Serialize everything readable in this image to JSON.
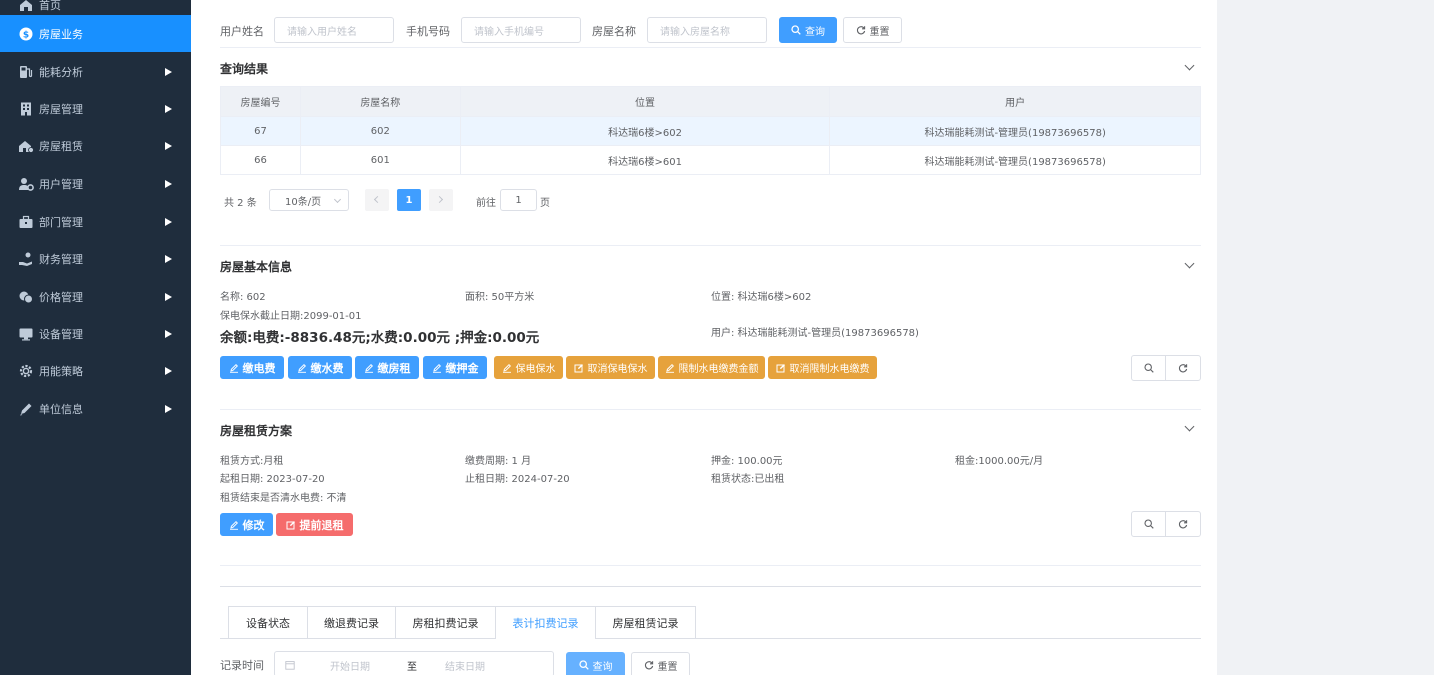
{
  "sidebar": {
    "items": [
      {
        "label": "首页",
        "icon": "home-icon"
      },
      {
        "label": "房屋业务",
        "icon": "dollar-icon",
        "active": true
      },
      {
        "label": "能耗分析",
        "icon": "gas-pump-icon"
      },
      {
        "label": "房屋管理",
        "icon": "building-icon"
      },
      {
        "label": "房屋租赁",
        "icon": "house-rent-icon"
      },
      {
        "label": "用户管理",
        "icon": "user-gear-icon"
      },
      {
        "label": "部门管理",
        "icon": "briefcase-icon"
      },
      {
        "label": "财务管理",
        "icon": "hand-money-icon"
      },
      {
        "label": "价格管理",
        "icon": "coins-icon"
      },
      {
        "label": "设备管理",
        "icon": "monitor-icon"
      },
      {
        "label": "用能策略",
        "icon": "gear-icon"
      },
      {
        "label": "单位信息",
        "icon": "pen-icon"
      }
    ]
  },
  "search": {
    "user_name_label": "用户姓名",
    "user_name_placeholder": "请输入用户姓名",
    "phone_label": "手机号码",
    "phone_placeholder": "请输入手机编号",
    "house_name_label": "房屋名称",
    "house_name_placeholder": "请输入房屋名称",
    "query_label": "查询",
    "reset_label": "重置"
  },
  "results": {
    "title": "查询结果",
    "columns": [
      "房屋编号",
      "房屋名称",
      "位置",
      "用户"
    ],
    "rows": [
      {
        "id": "67",
        "name": "602",
        "location": "科达瑞6楼>602",
        "user": "科达瑞能耗测试-管理员(19873696578)"
      },
      {
        "id": "66",
        "name": "601",
        "location": "科达瑞6楼>601",
        "user": "科达瑞能耗测试-管理员(19873696578)"
      }
    ],
    "pagination": {
      "total": "共 2 条",
      "page_size": "10条/页",
      "current_page": "1",
      "goto_prefix": "前往",
      "goto_value": "1",
      "goto_suffix": "页"
    }
  },
  "basic_info": {
    "title": "房屋基本信息",
    "name": "名称: 602",
    "area": "面积: 50平方米",
    "location": "位置: 科达瑞6楼>602",
    "power_protect_date": "保电保水截止日期:2099-01-01",
    "balance": "余额:电费:-8836.48元;水费:0.00元 ;押金:0.00元",
    "user": "用户: 科达瑞能耗测试-管理员(19873696578)",
    "buttons": [
      {
        "label": "缴电费",
        "type": "primary"
      },
      {
        "label": "缴水费",
        "type": "primary"
      },
      {
        "label": "缴房租",
        "type": "primary"
      },
      {
        "label": "缴押金",
        "type": "primary"
      },
      {
        "label": "保电保水",
        "type": "warn"
      },
      {
        "label": "取消保电保水",
        "type": "warn"
      },
      {
        "label": "限制水电缴费金额",
        "type": "warn"
      },
      {
        "label": "取消限制水电缴费",
        "type": "warn"
      }
    ]
  },
  "rent_plan": {
    "title": "房屋租赁方案",
    "rent_type": "租赁方式:月租",
    "pay_cycle": "缴费周期: 1 月",
    "deposit": "押金: 100.00元",
    "rent": "租金:1000.00元/月",
    "start_date": "起租日期: 2023-07-20",
    "end_date": "止租日期: 2024-07-20",
    "status": "租赁状态:已出租",
    "clear_on_end": "租赁结束是否清水电费: 不清",
    "edit_label": "修改",
    "terminate_label": "提前退租"
  },
  "records": {
    "tabs": [
      "设备状态",
      "缴退费记录",
      "房租扣费记录",
      "表计扣费记录",
      "房屋租赁记录"
    ],
    "active_tab": 3,
    "time_label": "记录时间",
    "start_placeholder": "开始日期",
    "range_sep": "至",
    "end_placeholder": "结束日期",
    "query_label": "查询",
    "reset_label": "重置"
  },
  "colors": {
    "sidebar_bg": "#1f2d3d",
    "active_bg": "#1890ff",
    "primary": "#409eff",
    "warning": "#e6a23c",
    "danger": "#f56c6c"
  }
}
